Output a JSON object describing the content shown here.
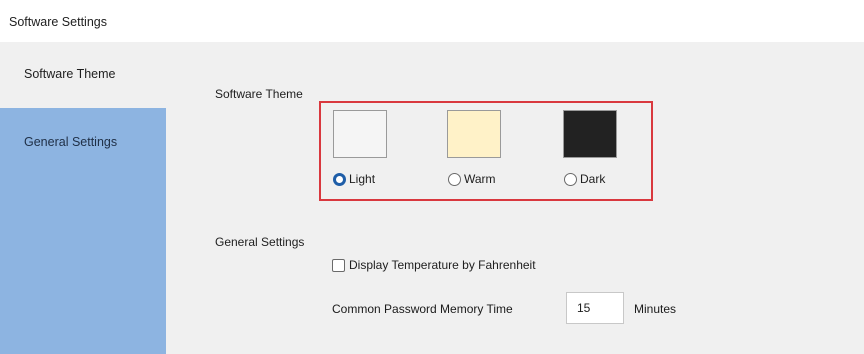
{
  "window": {
    "title": "Software Settings"
  },
  "sidebar": {
    "items": [
      {
        "label": "Software Theme",
        "active": true
      },
      {
        "label": "General Settings",
        "active": false
      }
    ]
  },
  "theme": {
    "section_label": "Software Theme",
    "options": [
      {
        "label": "Light",
        "swatch_color": "#f5f5f5",
        "selected": true
      },
      {
        "label": "Warm",
        "swatch_color": "#fff2c8",
        "selected": false
      },
      {
        "label": "Dark",
        "swatch_color": "#222222",
        "selected": false
      }
    ],
    "highlight_color": "#d9383e"
  },
  "general": {
    "section_label": "General Settings",
    "fahrenheit_label": "Display Temperature by Fahrenheit",
    "fahrenheit_checked": false,
    "password_label": "Common Password Memory Time",
    "password_value": "15",
    "password_unit": "Minutes"
  },
  "colors": {
    "sidebar_bg": "#8db4e1",
    "panel_bg": "#f0f0f0",
    "radio_selected": "#1f5ea8"
  }
}
